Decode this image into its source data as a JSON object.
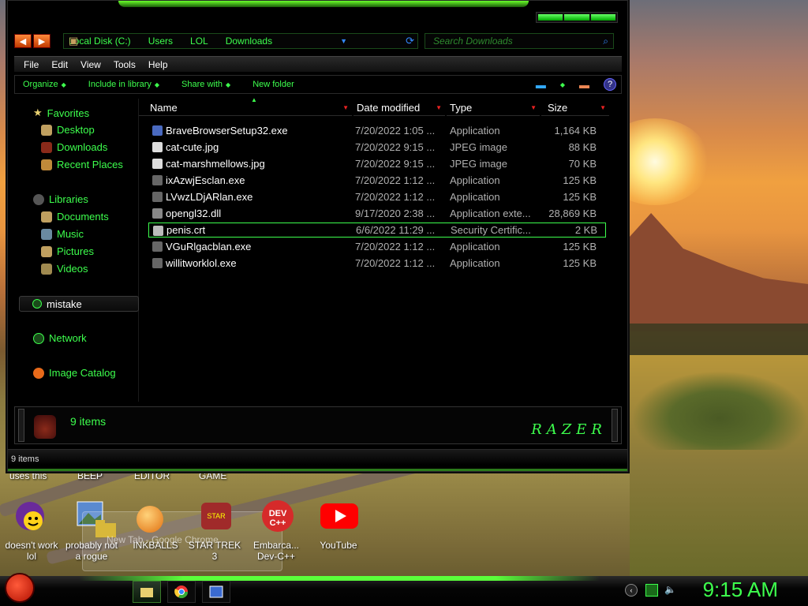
{
  "explorer": {
    "address": [
      "Local Disk (C:)",
      "Users",
      "LOL",
      "Downloads"
    ],
    "search_placeholder": "Search Downloads",
    "menu": [
      "File",
      "Edit",
      "View",
      "Tools",
      "Help"
    ],
    "commands": [
      "Organize",
      "Include in library",
      "Share with",
      "New folder"
    ],
    "nav": {
      "favorites": "Favorites",
      "desktop": "Desktop",
      "downloads": "Downloads",
      "recent": "Recent Places",
      "libraries": "Libraries",
      "documents": "Documents",
      "music": "Music",
      "pictures": "Pictures",
      "videos": "Videos",
      "mistake": "mistake",
      "network": "Network",
      "image_catalog": "Image Catalog"
    },
    "columns": [
      "Name",
      "Date modified",
      "Type",
      "Size"
    ],
    "files": [
      {
        "name": "BraveBrowserSetup32.exe",
        "date": "7/20/2022 1:05 ...",
        "type": "Application",
        "size": "1,164 KB"
      },
      {
        "name": "cat-cute.jpg",
        "date": "7/20/2022 9:15 ...",
        "type": "JPEG image",
        "size": "88 KB"
      },
      {
        "name": "cat-marshmellows.jpg",
        "date": "7/20/2022 9:15 ...",
        "type": "JPEG image",
        "size": "70 KB"
      },
      {
        "name": "ixAzwjEsclan.exe",
        "date": "7/20/2022 1:12 ...",
        "type": "Application",
        "size": "125 KB"
      },
      {
        "name": "LVwzLDjARlan.exe",
        "date": "7/20/2022 1:12 ...",
        "type": "Application",
        "size": "125 KB"
      },
      {
        "name": "opengl32.dll",
        "date": "9/17/2020 2:38 ...",
        "type": "Application exte...",
        "size": "28,869 KB"
      },
      {
        "name": "penis.crt",
        "date": "6/6/2022 11:29 ...",
        "type": "Security Certific...",
        "size": "2 KB"
      },
      {
        "name": "VGuRlgacblan.exe",
        "date": "7/20/2022 1:12 ...",
        "type": "Application",
        "size": "125 KB"
      },
      {
        "name": "willitworklol.exe",
        "date": "7/20/2022 1:12 ...",
        "type": "Application",
        "size": "125 KB"
      }
    ],
    "details_count": "9 items",
    "razer_logo": "RAZER",
    "status": "9 items"
  },
  "desktop": {
    "top_labels": [
      "uses this",
      "BEEP",
      "EDITOR",
      "GAME"
    ],
    "icons": [
      {
        "label1": "doesn't work",
        "label2": "lol"
      },
      {
        "label1": "probably not",
        "label2": "a rogue"
      },
      {
        "label1": "INKBALLS",
        "label2": ""
      },
      {
        "label1": "STAR TREK",
        "label2": "3"
      },
      {
        "label1": "Embarca...",
        "label2": "Dev-C++"
      },
      {
        "label1": "YouTube",
        "label2": ""
      }
    ],
    "thumb_labels": [
      "New Tab - Google Chrome"
    ]
  },
  "taskbar": {
    "clock": "9:15 AM"
  },
  "colors": {
    "accent": "#3dff4d",
    "selection": "#3dff4d",
    "header_arrow": "#ee2222"
  }
}
